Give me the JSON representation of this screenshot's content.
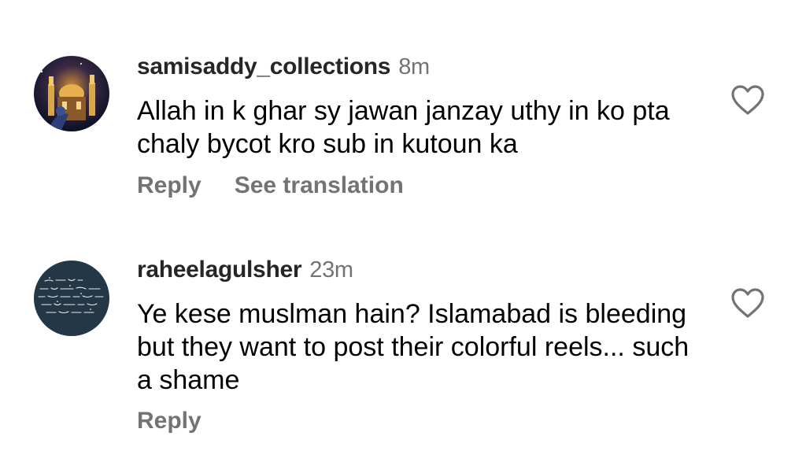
{
  "comments": [
    {
      "username": "samisaddy_collections",
      "time": "8m",
      "text": "Allah in k ghar sy jawan janzay uthy in ko pta chaly bycot kro sub in kutoun ka",
      "reply_label": "Reply",
      "translation_label": "See translation",
      "avatar_icon": "shrine-night-photo",
      "like_icon": "heart-outline-icon"
    },
    {
      "username": "raheelagulsher",
      "time": "23m",
      "text": "Ye kese muslman hain? Islamabad is bleeding but they want to post their colorful reels... such a shame",
      "reply_label": "Reply",
      "avatar_icon": "urdu-poetry-image",
      "like_icon": "heart-outline-icon"
    }
  ],
  "colors": {
    "username": "#262626",
    "secondary": "#737373",
    "icon_stroke": "#737373",
    "avatar2_bg": "#243747"
  }
}
